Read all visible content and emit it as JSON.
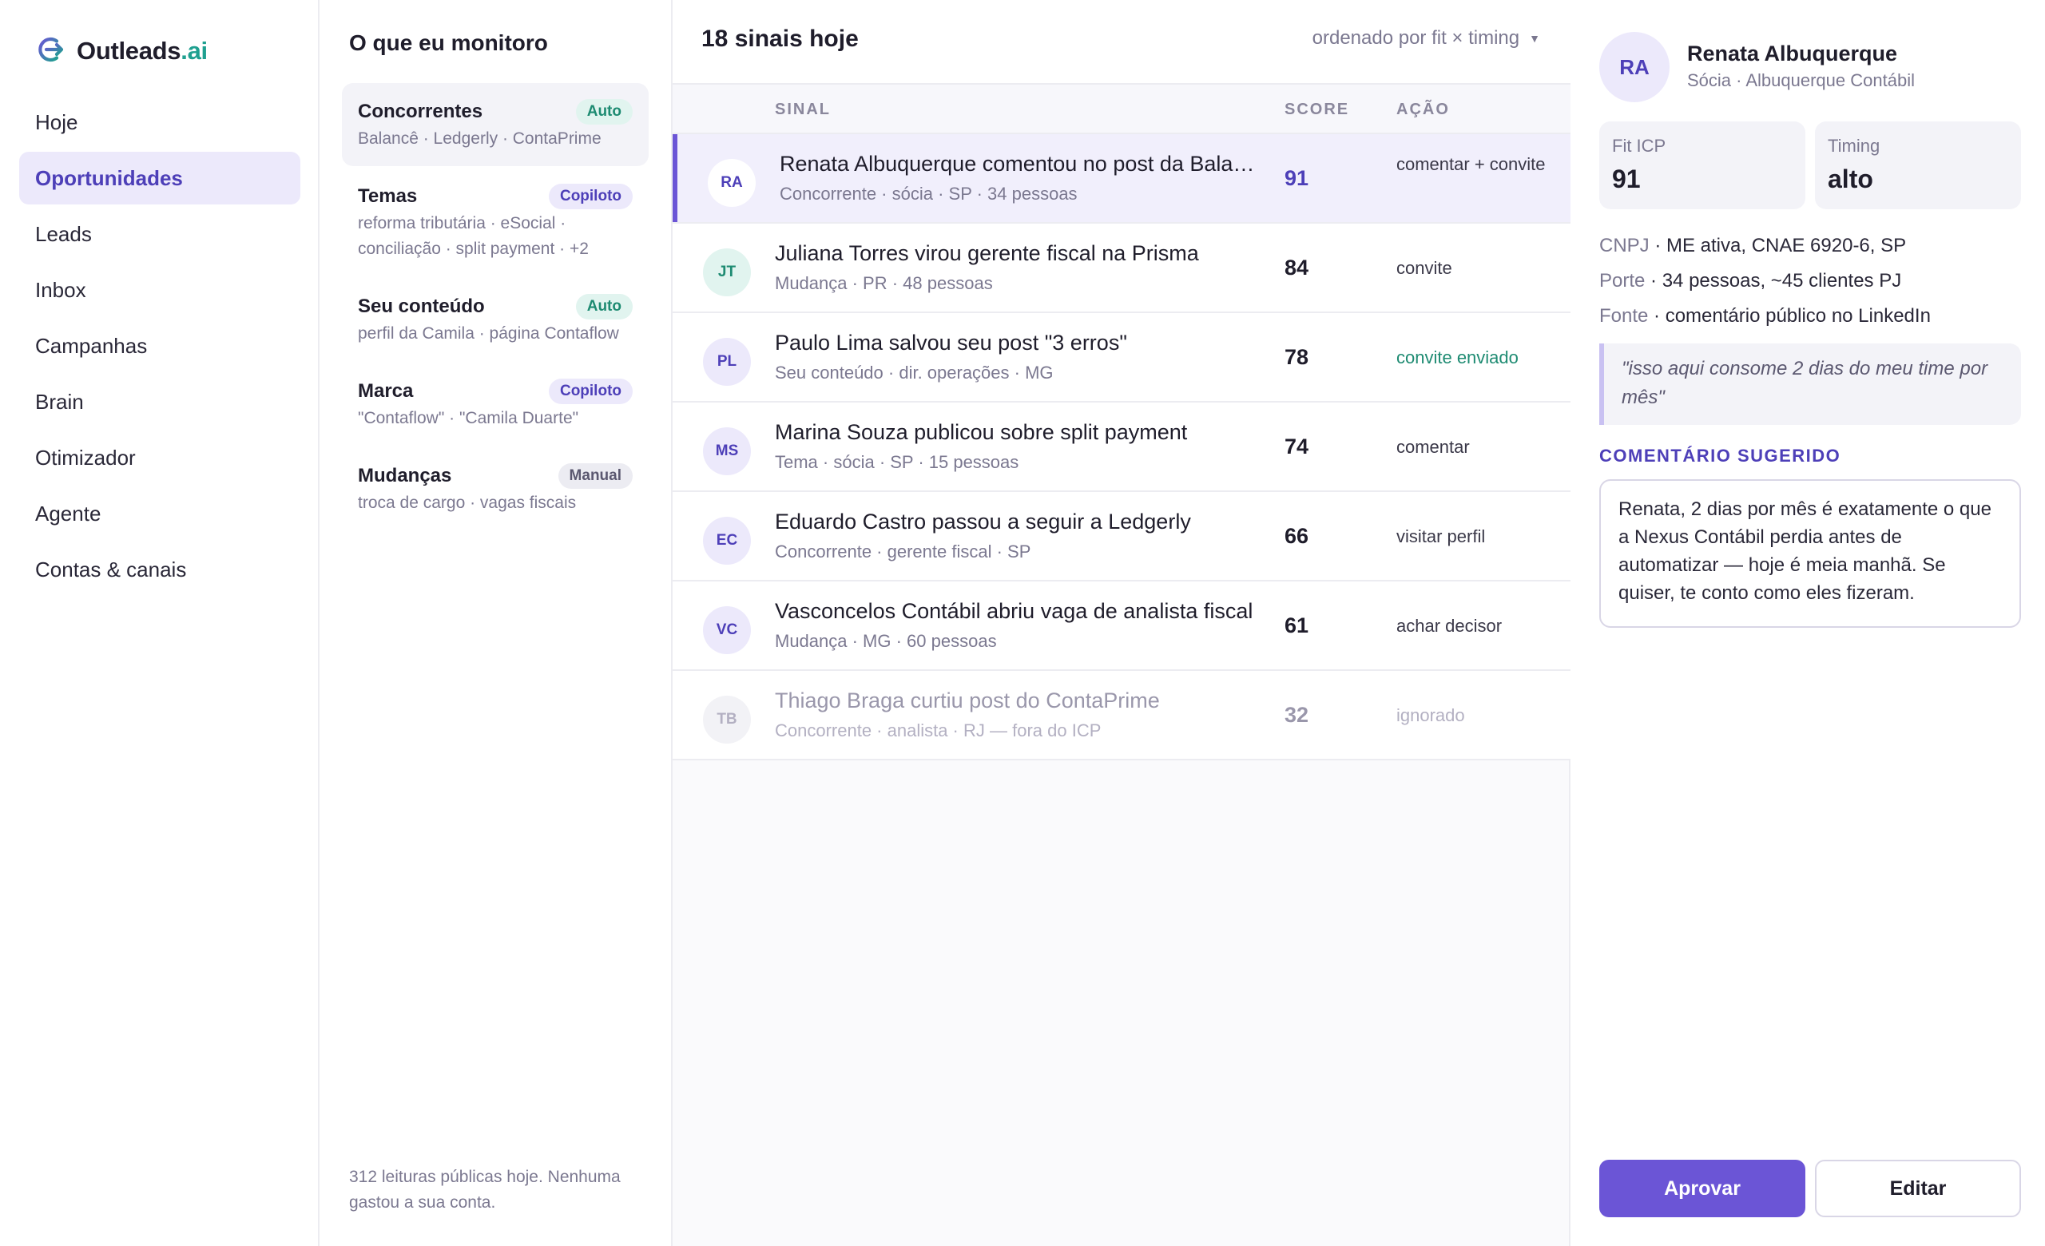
{
  "colors": {
    "accent": "#6b55d6",
    "accent_soft": "#ece9fb",
    "teal": "#1e8b72",
    "muted_text": "#7b7890"
  },
  "brand": {
    "icon": "outleads-logo-icon",
    "name": "Outleads",
    "ext": ".ai"
  },
  "nav": [
    {
      "label": "Hoje"
    },
    {
      "label": "Oportunidades",
      "active": true
    },
    {
      "label": "Leads"
    },
    {
      "label": "Inbox"
    },
    {
      "label": "Campanhas"
    },
    {
      "label": "Brain"
    },
    {
      "label": "Otimizador"
    },
    {
      "label": "Agente"
    },
    {
      "label": "Contas & canais"
    }
  ],
  "monitor": {
    "title": "O que eu monitoro",
    "items": [
      {
        "name": "Concorrentes",
        "badge": "Auto",
        "desc": "Balancê · Ledgerly · ContaPrime"
      },
      {
        "name": "Temas",
        "badge": "Copiloto",
        "desc": "reforma tributária · eSocial · conciliação · split payment · +2"
      },
      {
        "name": "Seu conteúdo",
        "badge": "Auto",
        "desc": "perfil da Camila · página Contaflow"
      },
      {
        "name": "Marca",
        "badge": "Copiloto",
        "desc": "\"Contaflow\" · \"Camila Duarte\""
      },
      {
        "name": "Mudanças",
        "badge": "Manual",
        "desc": "troca de cargo · vagas fiscais"
      }
    ],
    "footer": "312 leituras públicas hoje. Nenhuma gastou a sua conta."
  },
  "signals": {
    "count": "18 sinais hoje",
    "sort_label": "ordenado por fit × timing",
    "columns": {
      "signal": "SINAL",
      "score": "SCORE",
      "action": "AÇÃO"
    },
    "rows": [
      {
        "initials": "RA",
        "title": "Renata Albuquerque comentou no post da Balancê",
        "meta": "Concorrente · sócia · SP · 34 pessoas",
        "score": "91",
        "action": "comentar + convite"
      },
      {
        "initials": "JT",
        "title": "Juliana Torres virou gerente fiscal na Prisma",
        "meta": "Mudança · PR · 48 pessoas",
        "score": "84",
        "action": "convite"
      },
      {
        "initials": "PL",
        "title": "Paulo Lima salvou seu post \"3 erros\"",
        "meta": "Seu conteúdo · dir. operações · MG",
        "score": "78",
        "action": "convite enviado"
      },
      {
        "initials": "MS",
        "title": "Marina Souza publicou sobre split payment",
        "meta": "Tema · sócia · SP · 15 pessoas",
        "score": "74",
        "action": "comentar"
      },
      {
        "initials": "EC",
        "title": "Eduardo Castro passou a seguir a Ledgerly",
        "meta": "Concorrente · gerente fiscal · SP",
        "score": "66",
        "action": "visitar perfil"
      },
      {
        "initials": "VC",
        "title": "Vasconcelos Contábil abriu vaga de analista fiscal",
        "meta": "Mudança · MG · 60 pessoas",
        "score": "61",
        "action": "achar decisor"
      },
      {
        "initials": "TB",
        "title": "Thiago Braga curtiu post do ContaPrime",
        "meta": "Concorrente · analista · RJ — fora do ICP",
        "score": "32",
        "action": "ignorado"
      }
    ]
  },
  "detail": {
    "initials": "RA",
    "name": "Renata Albuquerque",
    "role": "Sócia · Albuquerque Contábil",
    "fit_label": "Fit ICP",
    "fit_value": "91",
    "timing_label": "Timing",
    "timing_value": "alto",
    "facts": [
      {
        "key": "CNPJ",
        "value": "ME ativa, CNAE 6920-6, SP"
      },
      {
        "key": "Porte",
        "value": "34 pessoas, ~45 clientes PJ"
      },
      {
        "key": "Fonte",
        "value": "comentário público no LinkedIn"
      }
    ],
    "quote": "\"isso aqui consome 2 dias do meu time por mês\"",
    "suggested_label": "COMENTÁRIO SUGERIDO",
    "suggested_text": "Renata, 2 dias por mês é exatamente o que a Nexus Contábil perdia antes de automatizar — hoje é meia manhã. Se quiser, te conto como eles fizeram.",
    "approve_label": "Aprovar",
    "edit_label": "Editar"
  }
}
